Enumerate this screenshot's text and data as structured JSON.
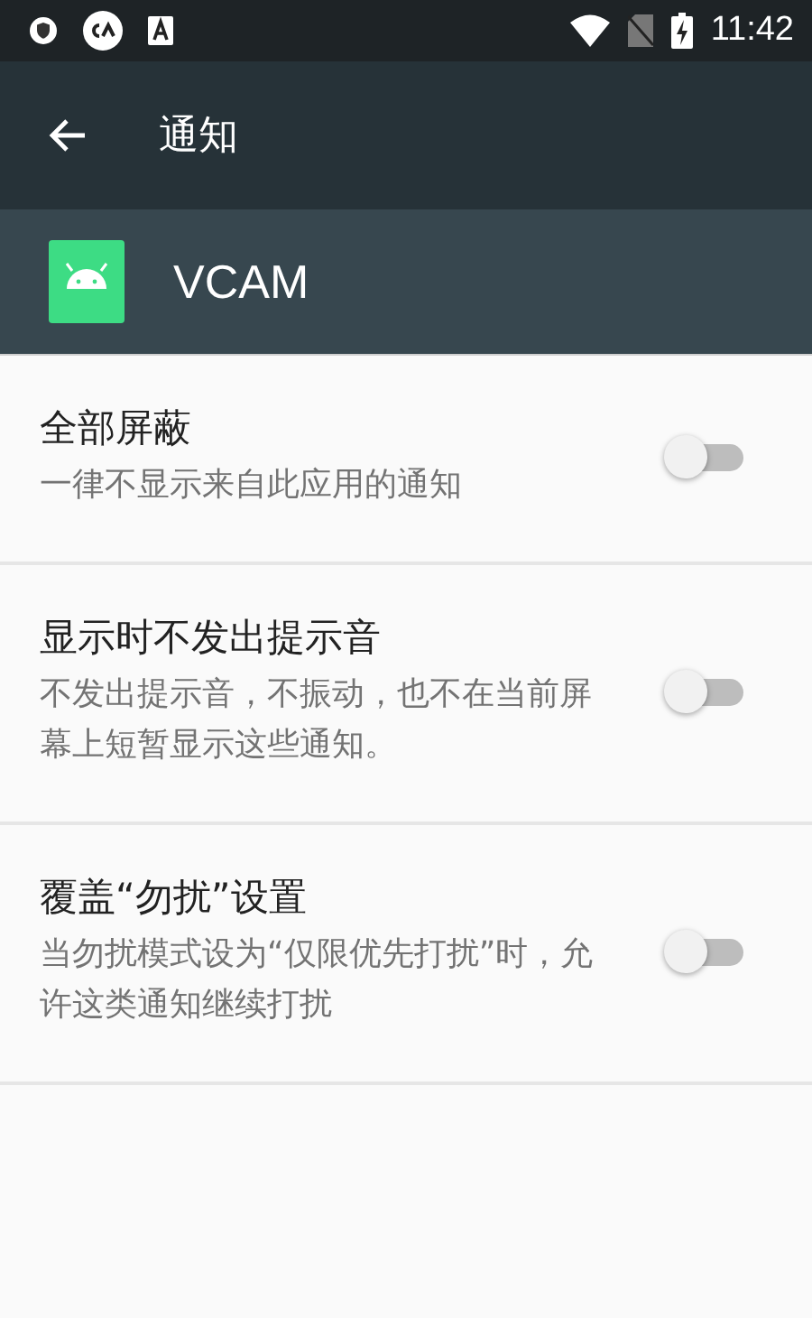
{
  "status_bar": {
    "time": "11:42"
  },
  "toolbar": {
    "title": "通知"
  },
  "app": {
    "name": "VCAM"
  },
  "settings": [
    {
      "title": "全部屏蔽",
      "summary": "一律不显示来自此应用的通知",
      "on": false
    },
    {
      "title": "显示时不发出提示音",
      "summary": "不发出提示音，不振动，也不在当前屏幕上短暂显示这些通知。",
      "on": false
    },
    {
      "title": "覆盖“勿扰”设置",
      "summary": "当勿扰模式设为“仅限优先打扰”时，允许这类通知继续打扰",
      "on": false
    }
  ]
}
